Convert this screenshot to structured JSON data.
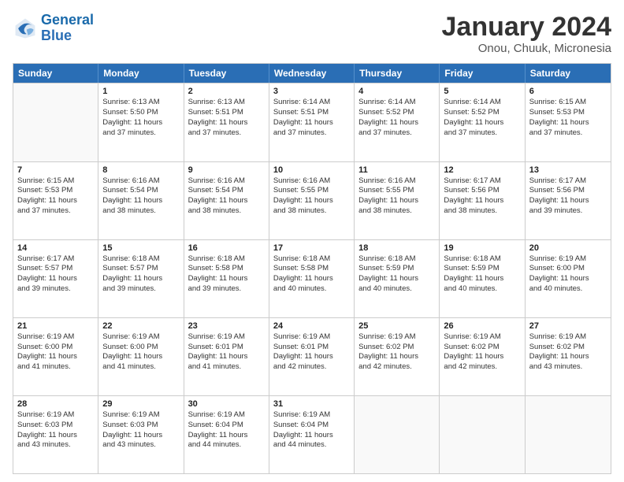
{
  "logo": {
    "line1": "General",
    "line2": "Blue"
  },
  "title": "January 2024",
  "subtitle": "Onou, Chuuk, Micronesia",
  "header_days": [
    "Sunday",
    "Monday",
    "Tuesday",
    "Wednesday",
    "Thursday",
    "Friday",
    "Saturday"
  ],
  "weeks": [
    [
      {
        "day": "",
        "sunrise": "",
        "sunset": "",
        "daylight": ""
      },
      {
        "day": "1",
        "sunrise": "Sunrise: 6:13 AM",
        "sunset": "Sunset: 5:50 PM",
        "daylight": "Daylight: 11 hours",
        "daylight2": "and 37 minutes."
      },
      {
        "day": "2",
        "sunrise": "Sunrise: 6:13 AM",
        "sunset": "Sunset: 5:51 PM",
        "daylight": "Daylight: 11 hours",
        "daylight2": "and 37 minutes."
      },
      {
        "day": "3",
        "sunrise": "Sunrise: 6:14 AM",
        "sunset": "Sunset: 5:51 PM",
        "daylight": "Daylight: 11 hours",
        "daylight2": "and 37 minutes."
      },
      {
        "day": "4",
        "sunrise": "Sunrise: 6:14 AM",
        "sunset": "Sunset: 5:52 PM",
        "daylight": "Daylight: 11 hours",
        "daylight2": "and 37 minutes."
      },
      {
        "day": "5",
        "sunrise": "Sunrise: 6:14 AM",
        "sunset": "Sunset: 5:52 PM",
        "daylight": "Daylight: 11 hours",
        "daylight2": "and 37 minutes."
      },
      {
        "day": "6",
        "sunrise": "Sunrise: 6:15 AM",
        "sunset": "Sunset: 5:53 PM",
        "daylight": "Daylight: 11 hours",
        "daylight2": "and 37 minutes."
      }
    ],
    [
      {
        "day": "7",
        "sunrise": "Sunrise: 6:15 AM",
        "sunset": "Sunset: 5:53 PM",
        "daylight": "Daylight: 11 hours",
        "daylight2": "and 37 minutes."
      },
      {
        "day": "8",
        "sunrise": "Sunrise: 6:16 AM",
        "sunset": "Sunset: 5:54 PM",
        "daylight": "Daylight: 11 hours",
        "daylight2": "and 38 minutes."
      },
      {
        "day": "9",
        "sunrise": "Sunrise: 6:16 AM",
        "sunset": "Sunset: 5:54 PM",
        "daylight": "Daylight: 11 hours",
        "daylight2": "and 38 minutes."
      },
      {
        "day": "10",
        "sunrise": "Sunrise: 6:16 AM",
        "sunset": "Sunset: 5:55 PM",
        "daylight": "Daylight: 11 hours",
        "daylight2": "and 38 minutes."
      },
      {
        "day": "11",
        "sunrise": "Sunrise: 6:16 AM",
        "sunset": "Sunset: 5:55 PM",
        "daylight": "Daylight: 11 hours",
        "daylight2": "and 38 minutes."
      },
      {
        "day": "12",
        "sunrise": "Sunrise: 6:17 AM",
        "sunset": "Sunset: 5:56 PM",
        "daylight": "Daylight: 11 hours",
        "daylight2": "and 38 minutes."
      },
      {
        "day": "13",
        "sunrise": "Sunrise: 6:17 AM",
        "sunset": "Sunset: 5:56 PM",
        "daylight": "Daylight: 11 hours",
        "daylight2": "and 39 minutes."
      }
    ],
    [
      {
        "day": "14",
        "sunrise": "Sunrise: 6:17 AM",
        "sunset": "Sunset: 5:57 PM",
        "daylight": "Daylight: 11 hours",
        "daylight2": "and 39 minutes."
      },
      {
        "day": "15",
        "sunrise": "Sunrise: 6:18 AM",
        "sunset": "Sunset: 5:57 PM",
        "daylight": "Daylight: 11 hours",
        "daylight2": "and 39 minutes."
      },
      {
        "day": "16",
        "sunrise": "Sunrise: 6:18 AM",
        "sunset": "Sunset: 5:58 PM",
        "daylight": "Daylight: 11 hours",
        "daylight2": "and 39 minutes."
      },
      {
        "day": "17",
        "sunrise": "Sunrise: 6:18 AM",
        "sunset": "Sunset: 5:58 PM",
        "daylight": "Daylight: 11 hours",
        "daylight2": "and 40 minutes."
      },
      {
        "day": "18",
        "sunrise": "Sunrise: 6:18 AM",
        "sunset": "Sunset: 5:59 PM",
        "daylight": "Daylight: 11 hours",
        "daylight2": "and 40 minutes."
      },
      {
        "day": "19",
        "sunrise": "Sunrise: 6:18 AM",
        "sunset": "Sunset: 5:59 PM",
        "daylight": "Daylight: 11 hours",
        "daylight2": "and 40 minutes."
      },
      {
        "day": "20",
        "sunrise": "Sunrise: 6:19 AM",
        "sunset": "Sunset: 6:00 PM",
        "daylight": "Daylight: 11 hours",
        "daylight2": "and 40 minutes."
      }
    ],
    [
      {
        "day": "21",
        "sunrise": "Sunrise: 6:19 AM",
        "sunset": "Sunset: 6:00 PM",
        "daylight": "Daylight: 11 hours",
        "daylight2": "and 41 minutes."
      },
      {
        "day": "22",
        "sunrise": "Sunrise: 6:19 AM",
        "sunset": "Sunset: 6:00 PM",
        "daylight": "Daylight: 11 hours",
        "daylight2": "and 41 minutes."
      },
      {
        "day": "23",
        "sunrise": "Sunrise: 6:19 AM",
        "sunset": "Sunset: 6:01 PM",
        "daylight": "Daylight: 11 hours",
        "daylight2": "and 41 minutes."
      },
      {
        "day": "24",
        "sunrise": "Sunrise: 6:19 AM",
        "sunset": "Sunset: 6:01 PM",
        "daylight": "Daylight: 11 hours",
        "daylight2": "and 42 minutes."
      },
      {
        "day": "25",
        "sunrise": "Sunrise: 6:19 AM",
        "sunset": "Sunset: 6:02 PM",
        "daylight": "Daylight: 11 hours",
        "daylight2": "and 42 minutes."
      },
      {
        "day": "26",
        "sunrise": "Sunrise: 6:19 AM",
        "sunset": "Sunset: 6:02 PM",
        "daylight": "Daylight: 11 hours",
        "daylight2": "and 42 minutes."
      },
      {
        "day": "27",
        "sunrise": "Sunrise: 6:19 AM",
        "sunset": "Sunset: 6:02 PM",
        "daylight": "Daylight: 11 hours",
        "daylight2": "and 43 minutes."
      }
    ],
    [
      {
        "day": "28",
        "sunrise": "Sunrise: 6:19 AM",
        "sunset": "Sunset: 6:03 PM",
        "daylight": "Daylight: 11 hours",
        "daylight2": "and 43 minutes."
      },
      {
        "day": "29",
        "sunrise": "Sunrise: 6:19 AM",
        "sunset": "Sunset: 6:03 PM",
        "daylight": "Daylight: 11 hours",
        "daylight2": "and 43 minutes."
      },
      {
        "day": "30",
        "sunrise": "Sunrise: 6:19 AM",
        "sunset": "Sunset: 6:04 PM",
        "daylight": "Daylight: 11 hours",
        "daylight2": "and 44 minutes."
      },
      {
        "day": "31",
        "sunrise": "Sunrise: 6:19 AM",
        "sunset": "Sunset: 6:04 PM",
        "daylight": "Daylight: 11 hours",
        "daylight2": "and 44 minutes."
      },
      {
        "day": "",
        "sunrise": "",
        "sunset": "",
        "daylight": "",
        "daylight2": ""
      },
      {
        "day": "",
        "sunrise": "",
        "sunset": "",
        "daylight": "",
        "daylight2": ""
      },
      {
        "day": "",
        "sunrise": "",
        "sunset": "",
        "daylight": "",
        "daylight2": ""
      }
    ]
  ]
}
